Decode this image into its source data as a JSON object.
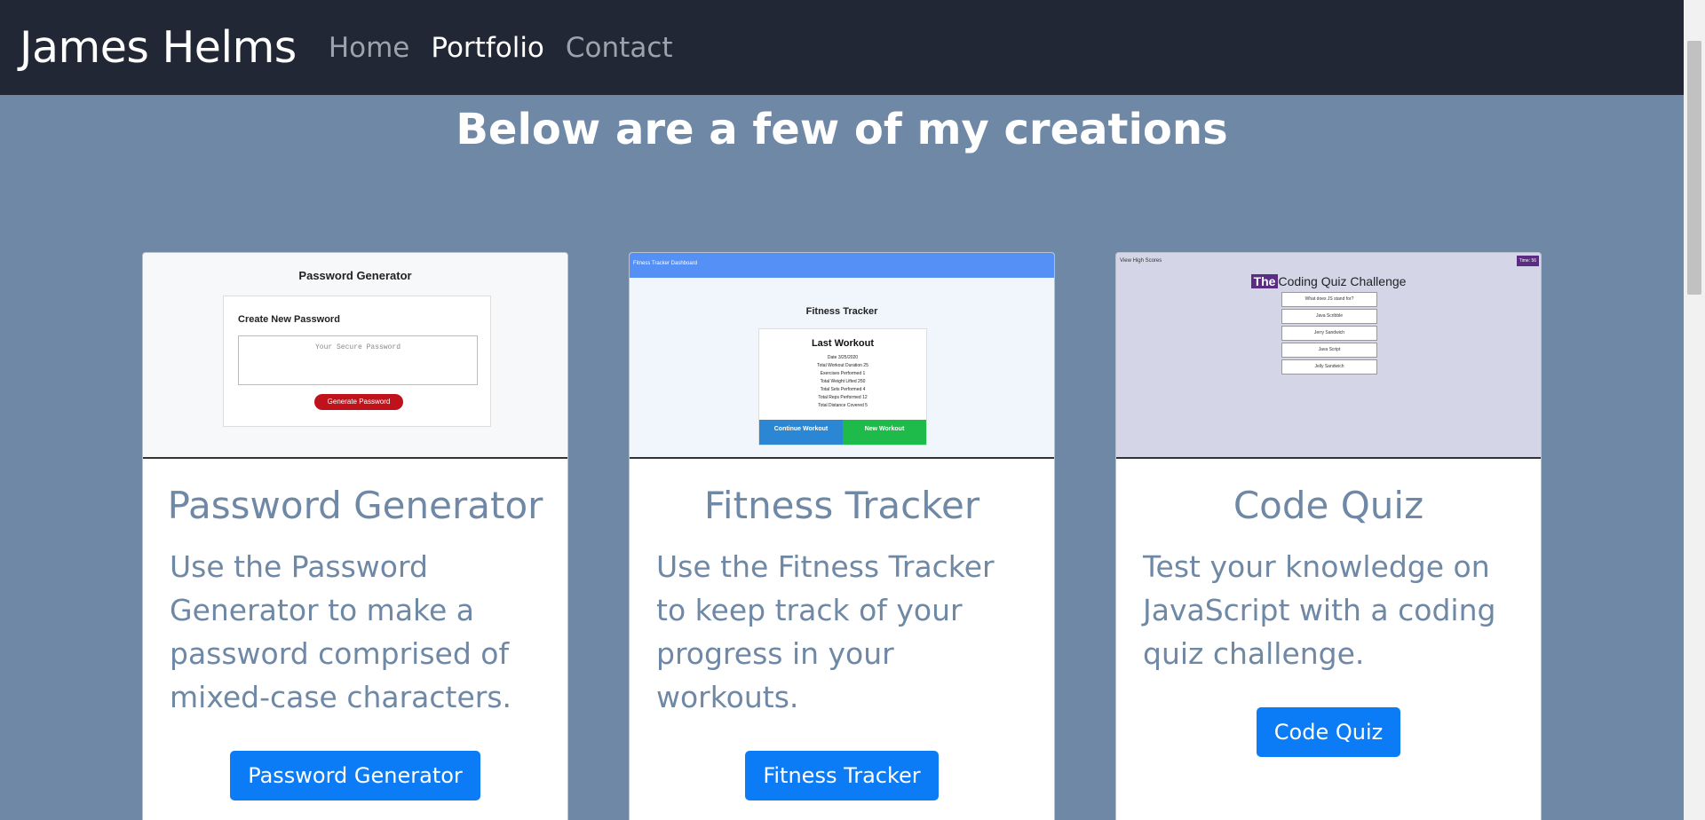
{
  "navbar": {
    "brand": "James Helms",
    "links": [
      {
        "label": "Home",
        "active": false
      },
      {
        "label": "Portfolio",
        "active": true
      },
      {
        "label": "Contact",
        "active": false
      }
    ]
  },
  "heading": "Below are a few of my creations",
  "cards": [
    {
      "title": "Password Generator",
      "description": "Use the Password Generator to make a password comprised of mixed-case characters.",
      "button": "Password Generator",
      "thumbnail": {
        "header": "Password Generator",
        "subtitle": "Create New Password",
        "placeholder": "Your Secure Password",
        "button": "Generate Password"
      }
    },
    {
      "title": "Fitness Tracker",
      "description": "Use the Fitness Tracker to keep track of your progress in your workouts.",
      "button": "Fitness Tracker",
      "thumbnail": {
        "bar": "Fitness Tracker Dashboard",
        "header": "Fitness Tracker",
        "card_title": "Last Workout",
        "lines": [
          "Date 3/25/2020",
          "Total Workout Duration 25",
          "Exercises Performed 1",
          "Total Weight Lifted 250",
          "Total Sets Performed 4",
          "Total Reps Performed 12",
          "Total Distance Covered 5"
        ],
        "btn_continue": "Continue Workout",
        "btn_new": "New Workout"
      }
    },
    {
      "title": "Code Quiz",
      "description": "Test your knowledge on JavaScript with a coding quiz challenge.",
      "button": "Code Quiz",
      "thumbnail": {
        "high_scores": "View High Scores",
        "time": "Time: 56",
        "title_prefix": "The",
        "title_rest": "Coding Quiz Challenge",
        "items": [
          "What does JS stand for?",
          "Java Scribble",
          "Jerry Sandwich",
          "Java Script",
          "Jelly Sandwich"
        ]
      }
    }
  ],
  "colors": {
    "page_bg": "#6e88a5",
    "navbar_bg": "#212734",
    "button_bg": "#0b7cf5",
    "card_text": "#6e88a5"
  }
}
